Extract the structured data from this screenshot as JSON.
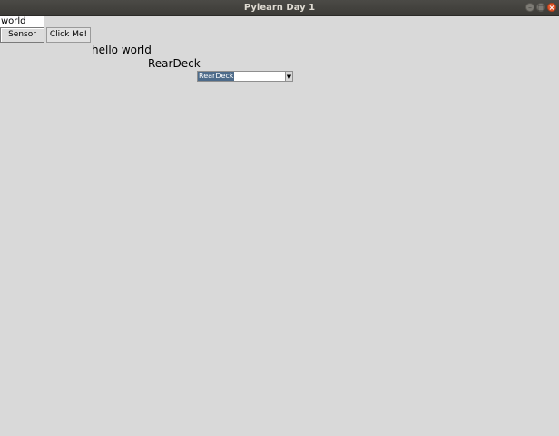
{
  "window": {
    "title": "Pylearn Day 1"
  },
  "form": {
    "entry_value": "world",
    "sensor_label": "Sensor",
    "click_label": "Click Me!",
    "greeting_text": "hello world",
    "selected_label_text": "RearDeck",
    "combo_value": "RearDeck"
  },
  "icons": {
    "minimize": "minimize-icon",
    "maximize": "maximize-icon",
    "close": "close-icon",
    "dropdown": "chevron-down-icon"
  },
  "colors": {
    "titlebar": "#3c3b37",
    "background": "#d9d9d9",
    "close_button": "#e4572a",
    "selection": "#4d6b8a"
  }
}
